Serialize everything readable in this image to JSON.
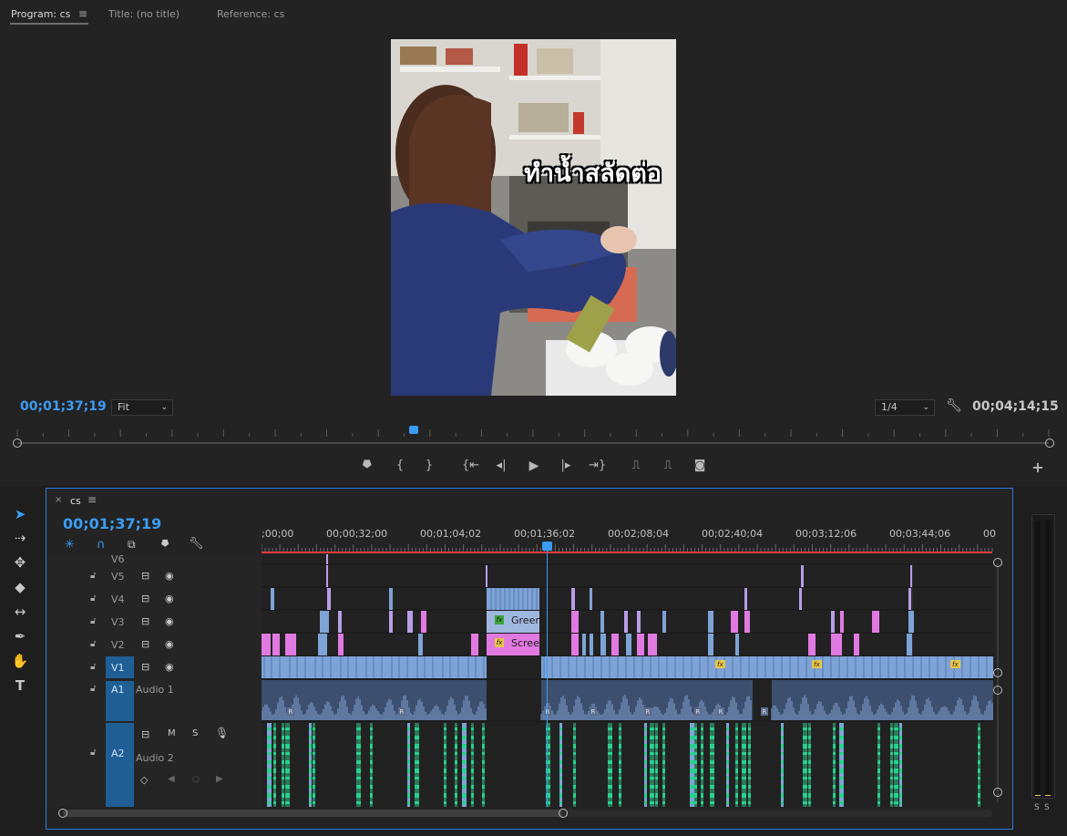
{
  "monitor": {
    "tabs": [
      {
        "label": "Program: cs"
      },
      {
        "label": "Title: (no title)"
      },
      {
        "label": "Reference: cs"
      }
    ],
    "menu_icon": "hamburger-icon",
    "overlay_caption": "ทำน้ำสลัดต่อ",
    "current_timecode": "00;01;37;19",
    "zoom": "Fit",
    "resolution": "1/4",
    "duration_timecode": "00;04;14;15",
    "playhead_position": 0.386,
    "transport_icons": [
      "marker-icon",
      "mark-in-icon",
      "mark-out-icon",
      "go-to-in-icon",
      "step-back-icon",
      "play-icon",
      "step-forward-icon",
      "go-to-out-icon",
      "lift-icon",
      "extract-icon",
      "export-frame-icon"
    ],
    "add_button": "+"
  },
  "tools": [
    "selection-tool-icon",
    "track-select-tool-icon",
    "ripple-edit-tool-icon",
    "razor-tool-icon",
    "slip-tool-icon",
    "pen-tool-icon",
    "hand-tool-icon",
    "type-tool-icon"
  ],
  "timeline": {
    "sequence_name": "cs",
    "close": "×",
    "current_timecode": "00;01;37;19",
    "ruler_labels": [
      ";00;00",
      "00;00;32;00",
      "00;01;04;02",
      "00;01;36;02",
      "00;02;08;04",
      "00;02;40;04",
      "00;03;12;06",
      "00;03;44;06",
      "00"
    ],
    "tracks": {
      "v6": "V6",
      "v5": "V5",
      "v4": "V4",
      "v3": "V3",
      "v2": "V2",
      "v1": "V1",
      "a1": "A1",
      "a2": "A2"
    },
    "a1_name": "Audio 1",
    "a2_name": "Audio 2",
    "a2_buttons": {
      "mute": "M",
      "solo": "S"
    },
    "clip_labels": {
      "green": "Green",
      "screen": "Screen"
    },
    "clip_fx_label": "fx",
    "audio_badge": "R",
    "meter_labels": [
      "S",
      "S"
    ]
  },
  "colors": {
    "accent": "#3b9cf3",
    "clip_video": "#7a9fd4",
    "clip_pink": "#e07ae1",
    "clip_audio2": "#22c283",
    "playhead_bar": "#e23a3a"
  }
}
